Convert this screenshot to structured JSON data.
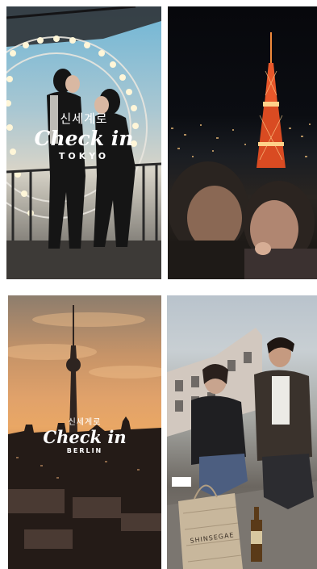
{
  "tiles": [
    {
      "id": "tokyo-couple",
      "overlay": {
        "korean": "신세계로",
        "brand": "Check in",
        "city": "TOKYO"
      }
    },
    {
      "id": "tokyo-tower"
    },
    {
      "id": "berlin",
      "overlay": {
        "korean": "신세계로",
        "brand": "Check in",
        "city": "BERLIN"
      }
    },
    {
      "id": "berlin-roof",
      "bag_text": "SHINSEGAE"
    }
  ],
  "colors": {
    "text": "#ffffff",
    "tokyo_sky": "#6fb6d6",
    "tower_orange": "#e8572a",
    "sunset": "#e9a765"
  }
}
